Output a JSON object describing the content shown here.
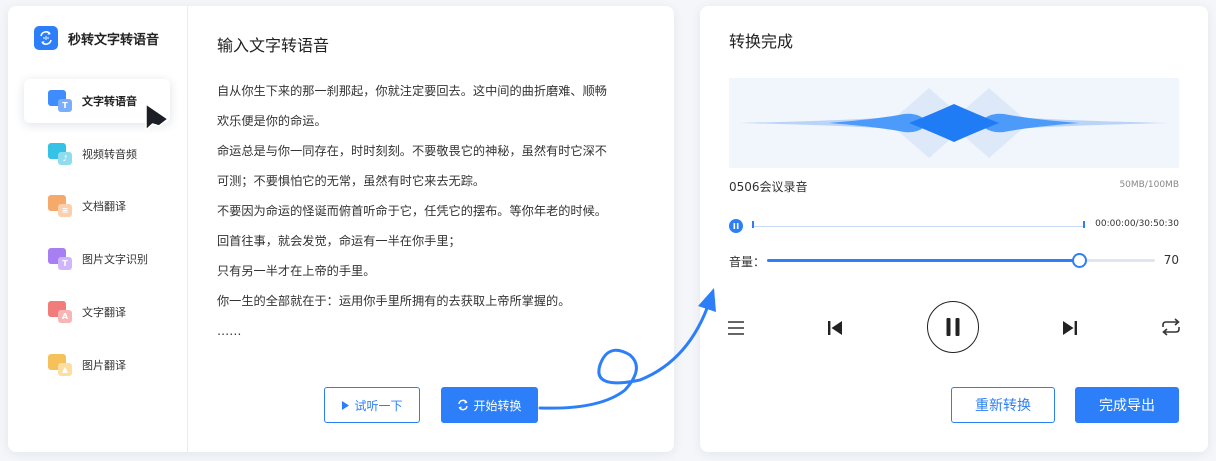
{
  "brand": {
    "name": "秒转文字转语音",
    "icon": "app-logo-icon"
  },
  "sidebar": {
    "items": [
      {
        "label": "文字转语音",
        "icon": "text-to-speech-icon",
        "active": true,
        "color": "#3f8cff",
        "badge": "T"
      },
      {
        "label": "视频转音频",
        "icon": "video-to-audio-icon",
        "active": false,
        "color": "#34c3e6",
        "badge": "♪"
      },
      {
        "label": "文档翻译",
        "icon": "document-translate-icon",
        "active": false,
        "color": "#f5a96b",
        "badge": "≡"
      },
      {
        "label": "图片文字识别",
        "icon": "image-ocr-icon",
        "active": false,
        "color": "#a77ff2",
        "badge": "T"
      },
      {
        "label": "文字翻译",
        "icon": "text-translate-icon",
        "active": false,
        "color": "#f27b7b",
        "badge": "A"
      },
      {
        "label": "图片翻译",
        "icon": "image-translate-icon",
        "active": false,
        "color": "#f5c15b",
        "badge": "▲"
      }
    ]
  },
  "editor": {
    "title": "输入文字转语音",
    "lines": [
      "自从你生下来的那一刹那起，你就注定要回去。这中间的曲折磨难、顺畅",
      "欢乐便是你的命运。",
      "命运总是与你一同存在，时时刻刻。不要敬畏它的神秘，虽然有时它深不",
      "可测；不要惧怕它的无常，虽然有时它来去无踪。",
      "不要因为命运的怪诞而俯首听命于它，任凭它的摆布。等你年老的时候。",
      "回首往事，就会发觉，命运有一半在你手里；",
      "只有另一半才在上帝的手里。",
      "你一生的全部就在于：运用你手里所拥有的去获取上帝所掌握的。",
      "……"
    ],
    "preview_button": "试听一下",
    "convert_button": "开始转换"
  },
  "result": {
    "title": "转换完成",
    "file_name": "0506会议录音",
    "file_size": "50MB/100MB",
    "time": "00:00:00/30:50:30",
    "progress": 0.0,
    "volume_label": "音量：",
    "volume": 70,
    "restart_button": "重新转换",
    "export_button": "完成导出"
  },
  "colors": {
    "accent": "#2d7ff9"
  }
}
